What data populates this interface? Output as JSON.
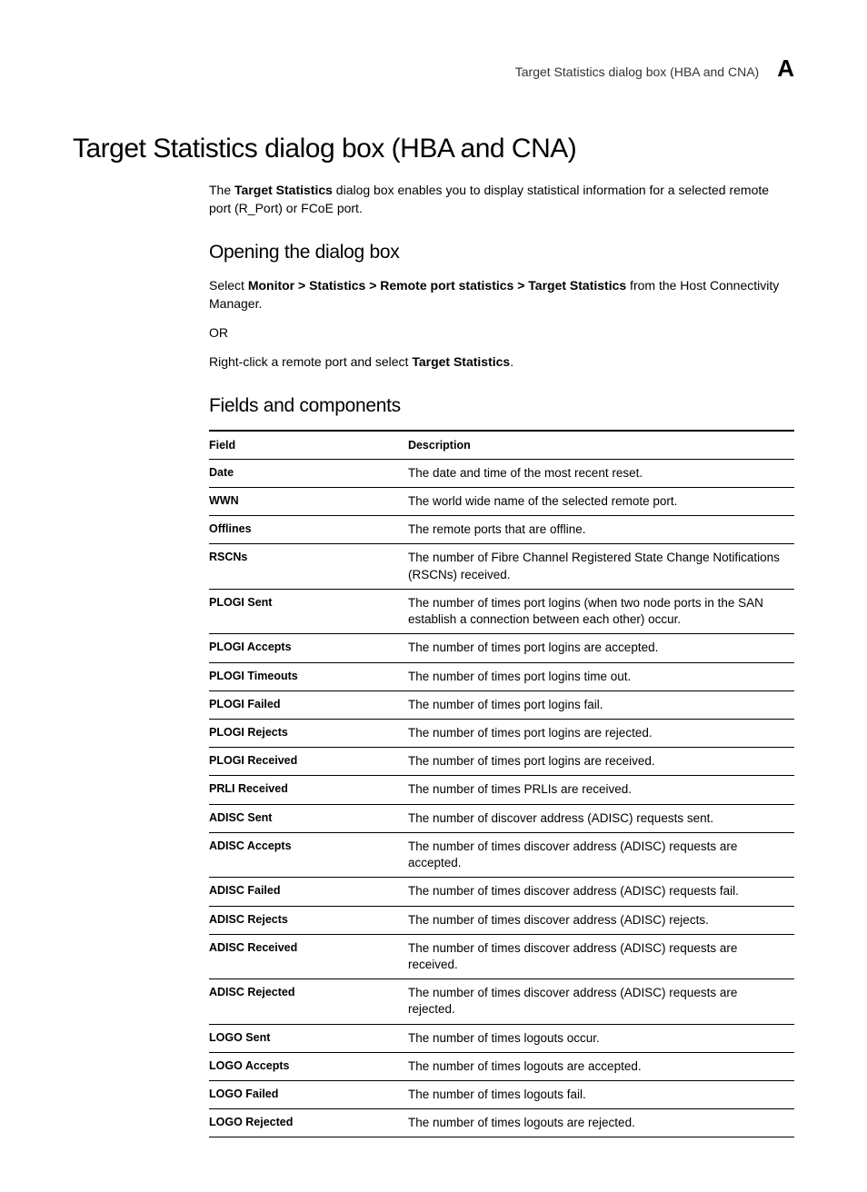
{
  "header": {
    "running_title": "Target Statistics dialog box (HBA and CNA)",
    "appendix_letter": "A"
  },
  "title": "Target Statistics dialog box (HBA and CNA)",
  "intro": {
    "prefix": "The ",
    "bold": "Target Statistics",
    "suffix": " dialog box enables you to display statistical information for a selected remote port (R_Port) or FCoE port."
  },
  "section_open": {
    "heading": "Opening the dialog box",
    "line1_prefix": "Select ",
    "line1_bold": "Monitor > Statistics > Remote port statistics > Target Statistics",
    "line1_suffix": " from the Host Connectivity Manager.",
    "or": "OR",
    "line2_prefix": "Right-click a remote port and select ",
    "line2_bold": "Target Statistics",
    "line2_suffix": "."
  },
  "section_fields": {
    "heading": "Fields and components",
    "col_field": "Field",
    "col_desc": "Description",
    "rows": [
      {
        "field": "Date",
        "desc": "The date and time of the most recent reset."
      },
      {
        "field": "WWN",
        "desc": "The world wide name of the selected remote port."
      },
      {
        "field": "Offlines",
        "desc": "The remote ports that are offline."
      },
      {
        "field": "RSCNs",
        "desc": "The number of Fibre Channel Registered State Change Notifications (RSCNs) received."
      },
      {
        "field": "PLOGI Sent",
        "desc": "The number of times port logins (when two node ports in the SAN establish a connection between each other) occur."
      },
      {
        "field": "PLOGI Accepts",
        "desc": "The number of times port logins are accepted."
      },
      {
        "field": "PLOGI Timeouts",
        "desc": "The number of times port logins time out."
      },
      {
        "field": "PLOGI Failed",
        "desc": "The number of times port logins fail."
      },
      {
        "field": "PLOGI Rejects",
        "desc": "The number of times port logins are rejected."
      },
      {
        "field": "PLOGI Received",
        "desc": "The number of times port logins are received."
      },
      {
        "field": "PRLI Received",
        "desc": "The number of times PRLIs are received."
      },
      {
        "field": "ADISC Sent",
        "desc": "The number of discover address (ADISC) requests sent."
      },
      {
        "field": "ADISC Accepts",
        "desc": "The number of times discover address (ADISC) requests are accepted."
      },
      {
        "field": "ADISC Failed",
        "desc": "The number of times discover address (ADISC) requests fail."
      },
      {
        "field": "ADISC Rejects",
        "desc": "The number of times discover address (ADISC) rejects."
      },
      {
        "field": "ADISC Received",
        "desc": "The number of times discover address (ADISC) requests are received."
      },
      {
        "field": "ADISC Rejected",
        "desc": "The number of times discover address (ADISC) requests are rejected."
      },
      {
        "field": "LOGO Sent",
        "desc": "The number of times logouts occur."
      },
      {
        "field": "LOGO Accepts",
        "desc": "The number of times logouts are accepted."
      },
      {
        "field": "LOGO Failed",
        "desc": "The number of times logouts fail."
      },
      {
        "field": "LOGO Rejected",
        "desc": "The number of times logouts are rejected."
      }
    ]
  }
}
